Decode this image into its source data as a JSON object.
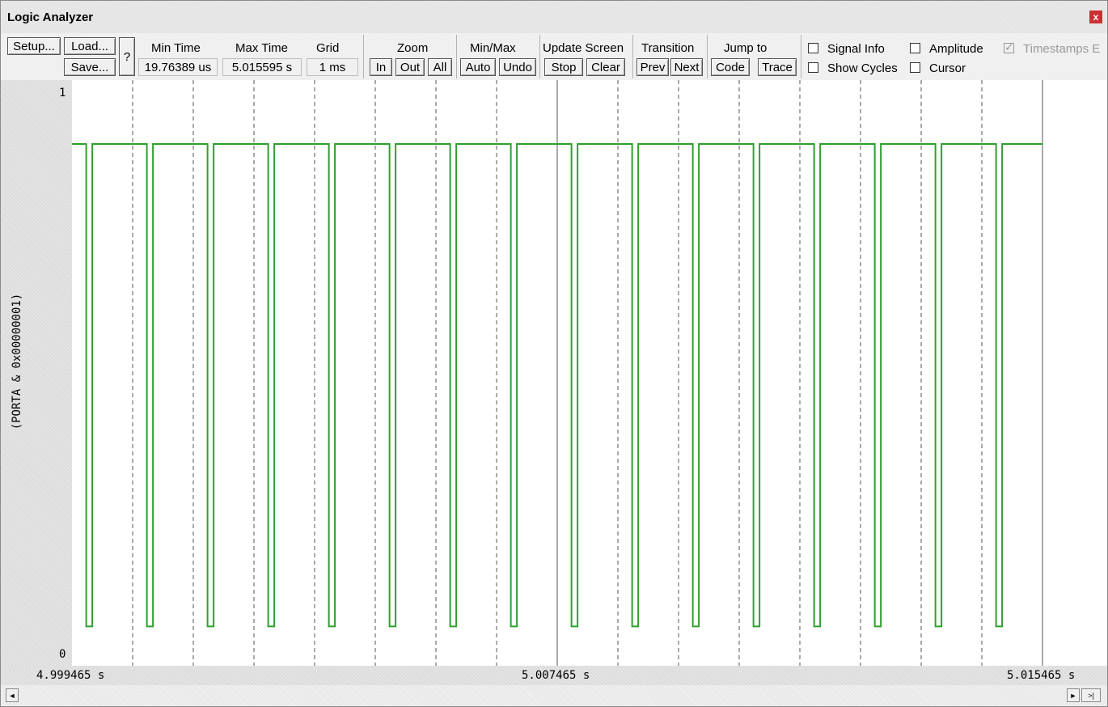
{
  "window": {
    "title": "Logic Analyzer",
    "close_glyph": "x"
  },
  "toolbar": {
    "setup": "Setup...",
    "load": "Load...",
    "save": "Save...",
    "help": "?",
    "min_time_label": "Min Time",
    "min_time_value": "19.76389 us",
    "max_time_label": "Max Time",
    "max_time_value": "5.015595 s",
    "grid_label": "Grid",
    "grid_value": "1 ms",
    "zoom_label": "Zoom",
    "zoom_in": "In",
    "zoom_out": "Out",
    "zoom_all": "All",
    "minmax_label": "Min/Max",
    "minmax_auto": "Auto",
    "minmax_undo": "Undo",
    "update_label": "Update Screen",
    "update_stop": "Stop",
    "update_clear": "Clear",
    "transition_label": "Transition",
    "transition_prev": "Prev",
    "transition_next": "Next",
    "jump_label": "Jump to",
    "jump_code": "Code",
    "jump_trace": "Trace",
    "signal_info": "Signal Info",
    "show_cycles": "Show Cycles",
    "amplitude": "Amplitude",
    "cursor": "Cursor",
    "timestamps": "Timestamps E",
    "signal_info_checked": false,
    "show_cycles_checked": false,
    "amplitude_checked": false,
    "cursor_checked": false,
    "timestamps_checked": true
  },
  "plot": {
    "signal_name": "(PORTA & 0x00000001)",
    "y_max_label": "1",
    "y_min_label": "0",
    "t_left": "4.999465  s",
    "t_mid": "5.007465  s",
    "t_right": "5.015465  s",
    "trace_color": "#2ca02c",
    "grid_color": "#555555"
  },
  "chart_data": {
    "type": "line",
    "x_unit": "s",
    "xlim": [
      4.999465,
      5.015465
    ],
    "ylim": [
      0,
      1
    ],
    "grid_ms": 1,
    "series": [
      {
        "name": "(PORTA & 0x00000001)",
        "high": 0.9,
        "low": 0.06,
        "pulse_low_times": [
          4.9997,
          5.0007,
          5.0017,
          5.0027,
          5.0037,
          5.0047,
          5.0057,
          5.0067,
          5.0077,
          5.0087,
          5.0097,
          5.0107,
          5.0117,
          5.0127,
          5.0137,
          5.0147
        ],
        "pulse_width": 0.0001
      }
    ]
  },
  "scrollbar": {
    "left": "◄",
    "right": "►",
    "end": ">|"
  }
}
